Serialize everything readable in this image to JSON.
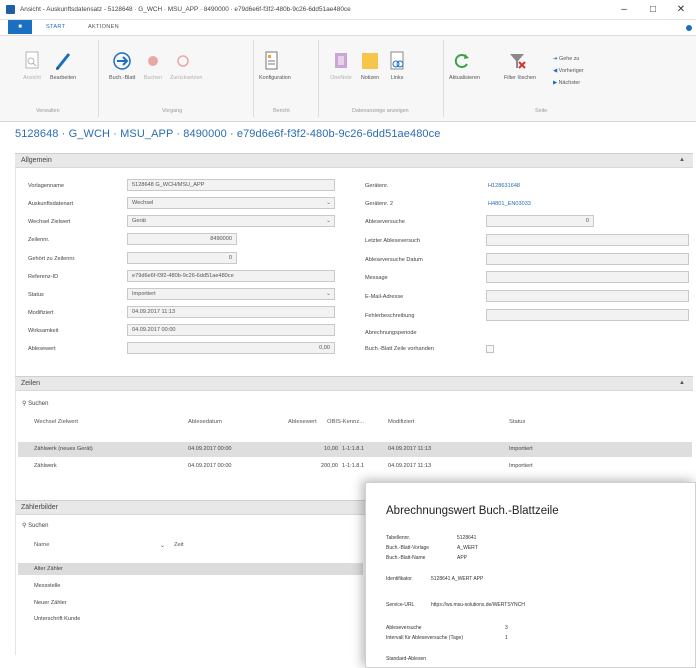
{
  "window": {
    "title": "Ansicht - Auskunftsdatensatz - 5128648 · G_WCH · MSU_APP · 8490000 · e79d6e6f-f3f2-480b-9c26-6dd51ae480ce",
    "minimize": "–",
    "maximize": "□",
    "close": "✕"
  },
  "ribbon": {
    "file_tab": "■",
    "tabs": [
      "START",
      "AKTIONEN"
    ],
    "buttons": {
      "ansicht": "Ansicht",
      "bearbeiten": "Bearbeiten",
      "buch_blatt": "Buch.-Blatt",
      "buchen": "Buchen",
      "zuruecksetzen": "Zurücksetzen",
      "konfiguration": "Konfiguration",
      "onenote": "OneNote",
      "notizen": "Notizen",
      "links": "Links",
      "aktualisieren": "Aktualisieren",
      "filter_loeschen": "Filter löschen"
    },
    "groups": {
      "verwalten": "Verwalten",
      "vorgang": "Vorgang",
      "bericht": "Bericht",
      "datenanzeige": "Datenanzeige anzeigen",
      "seite": "Seite"
    },
    "nav": [
      "Gehe zu",
      "Vorheriger",
      "Nächster"
    ]
  },
  "page_title": "5128648 · G_WCH · MSU_APP · 8490000 · e79d6e6f-f3f2-480b-9c26-6dd51ae480ce",
  "allgemein": {
    "title": "Allgemein",
    "left": [
      {
        "label": "Vorlagenname",
        "value": "5128648 G_WCH/MSU_APP"
      },
      {
        "label": "Auskunftsdatenart",
        "value": "Wechsel"
      },
      {
        "label": "Wechsel Zielwert",
        "value": "Gerät"
      },
      {
        "label": "Zeilennr.",
        "value": "8490000"
      },
      {
        "label": "Gehört zu Zeilennr.",
        "value": "0"
      },
      {
        "label": "Referenz-ID",
        "value": "e79d6e6f-f3f2-480b-9c26-6dd51ae480ce"
      },
      {
        "label": "Status",
        "value": "Importiert"
      },
      {
        "label": "Modifiziert",
        "value": "04.09.2017 11:13"
      },
      {
        "label": "Wirksamkeit",
        "value": "04.09.2017 00:00"
      },
      {
        "label": "Ablesewert",
        "value": "0,00"
      }
    ],
    "right": [
      {
        "label": "Gerätenr.",
        "value": "H128631648"
      },
      {
        "label": "Gerätenr. 2",
        "value": "H4801_EN03033"
      },
      {
        "label": "Ableseversuche",
        "value": "0"
      },
      {
        "label": "Letzter Ableseversuch",
        "value": ""
      },
      {
        "label": "Ableseversuche Datum",
        "value": ""
      },
      {
        "label": "Message",
        "value": ""
      },
      {
        "label": "E-Mail-Adresse",
        "value": ""
      },
      {
        "label": "Fehlerbeschreibung",
        "value": ""
      },
      {
        "label": "Abrechnungsperiode",
        "value": ""
      },
      {
        "label": "Buch.-Blatt Zeile vorhanden",
        "value": ""
      }
    ]
  },
  "zeilen": {
    "title": "Zeilen",
    "search": "Suchen",
    "columns": [
      "Wechsel Zielwert",
      "Ablesedatum",
      "Ablesewert",
      "OBIS-Kennz...",
      "Modifiziert",
      "Status"
    ],
    "rows": [
      [
        "Zählwerk (neues Gerät)",
        "04.09.2017 00:00",
        "10,00",
        "1-1:1.8.1",
        "04.09.2017 11:13",
        "Importiert"
      ],
      [
        "Zählwerk",
        "04.09.2017 00:00",
        "200,00",
        "1-1:1.8.1",
        "04.09.2017 11:13",
        "Importiert"
      ]
    ]
  },
  "zaehlerbilder": {
    "title": "Zählerbilder",
    "search": "Suchen",
    "col_name": "Name",
    "col_zeit": "Zeit",
    "items": [
      "Alter Zähler",
      "Messstelle",
      "Neuer Zähler",
      "Unterschrift Kunde"
    ]
  },
  "tooltip": {
    "title": "Abrechnungswert Buch.-Blattzeile",
    "rows": [
      {
        "k": "Tabellennr.",
        "v": "5128641"
      },
      {
        "k": "Buch.-Blatt-Vorlage",
        "v": "A_WERT"
      },
      {
        "k": "Buch.-Blatt-Name",
        "v": "APP"
      },
      {
        "k": "Identifikator",
        "v": "5128641 A_WERT APP"
      },
      {
        "k": "Service-URL",
        "v": "https://ws.msu-solutions.de/WERTSYNCH"
      },
      {
        "k": "Ableseversuche",
        "v": "3"
      },
      {
        "k": "Intervall für Ableseversuche (Tage)",
        "v": "1"
      },
      {
        "k": "Standard-Ablesen",
        "v": ""
      }
    ]
  }
}
